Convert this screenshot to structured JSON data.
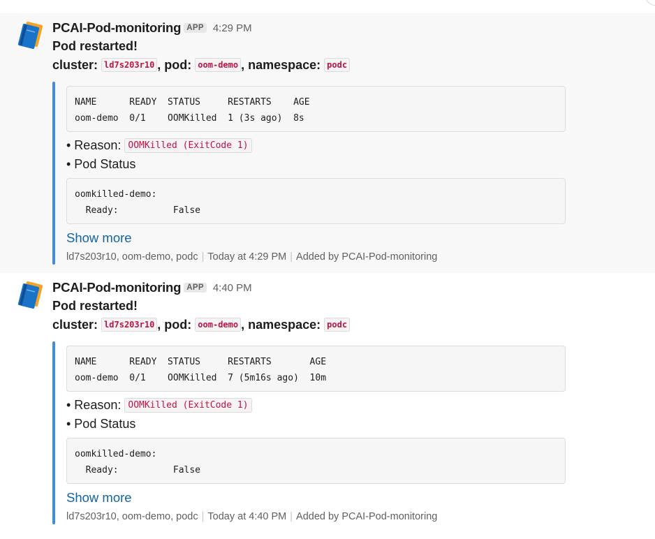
{
  "messages": [
    {
      "sender": "PCAI-Pod-monitoring",
      "badge": "APP",
      "time": "4:29 PM",
      "headline": "Pod restarted!",
      "labels": {
        "cluster": "cluster:",
        "pod": ", pod:",
        "namespace": ", namespace:"
      },
      "cluster": "ld7s203r10",
      "pod": "oom-demo",
      "namespace": "podc",
      "table": {
        "header": "NAME      READY  STATUS     RESTARTS    AGE",
        "row": "oom-demo  0/1    OOMKilled  1 (3s ago)  8s"
      },
      "reason_label": "• Reason:",
      "reason_value": "OOMKilled (ExitCode 1)",
      "status_label": "• Pod Status",
      "status_block": {
        "line1": "oomkilled-demo:",
        "line2": "  Ready:          False"
      },
      "show_more": "Show more",
      "footer": {
        "context": "ld7s203r10, oom-demo, podc",
        "time": "Today at 4:29 PM",
        "added_by": "Added by PCAI-Pod-monitoring"
      }
    },
    {
      "sender": "PCAI-Pod-monitoring",
      "badge": "APP",
      "time": "4:40 PM",
      "headline": "Pod restarted!",
      "labels": {
        "cluster": "cluster:",
        "pod": ", pod:",
        "namespace": ", namespace:"
      },
      "cluster": "ld7s203r10",
      "pod": "oom-demo",
      "namespace": "podc",
      "table": {
        "header": "NAME      READY  STATUS     RESTARTS       AGE",
        "row": "oom-demo  0/1    OOMKilled  7 (5m16s ago)  10m"
      },
      "reason_label": "• Reason:",
      "reason_value": "OOMKilled (ExitCode 1)",
      "status_label": "• Pod Status",
      "status_block": {
        "line1": "oomkilled-demo:",
        "line2": "  Ready:          False"
      },
      "show_more": "Show more",
      "footer": {
        "context": "ld7s203r10, oom-demo, podc",
        "time": "Today at 4:40 PM",
        "added_by": "Added by PCAI-Pod-monitoring"
      }
    }
  ],
  "icons": {
    "avatar": "blue-book-icon"
  },
  "colors": {
    "link": "#1264a3",
    "code_red": "#c01343",
    "attachment_bar": "#3d8de0"
  }
}
